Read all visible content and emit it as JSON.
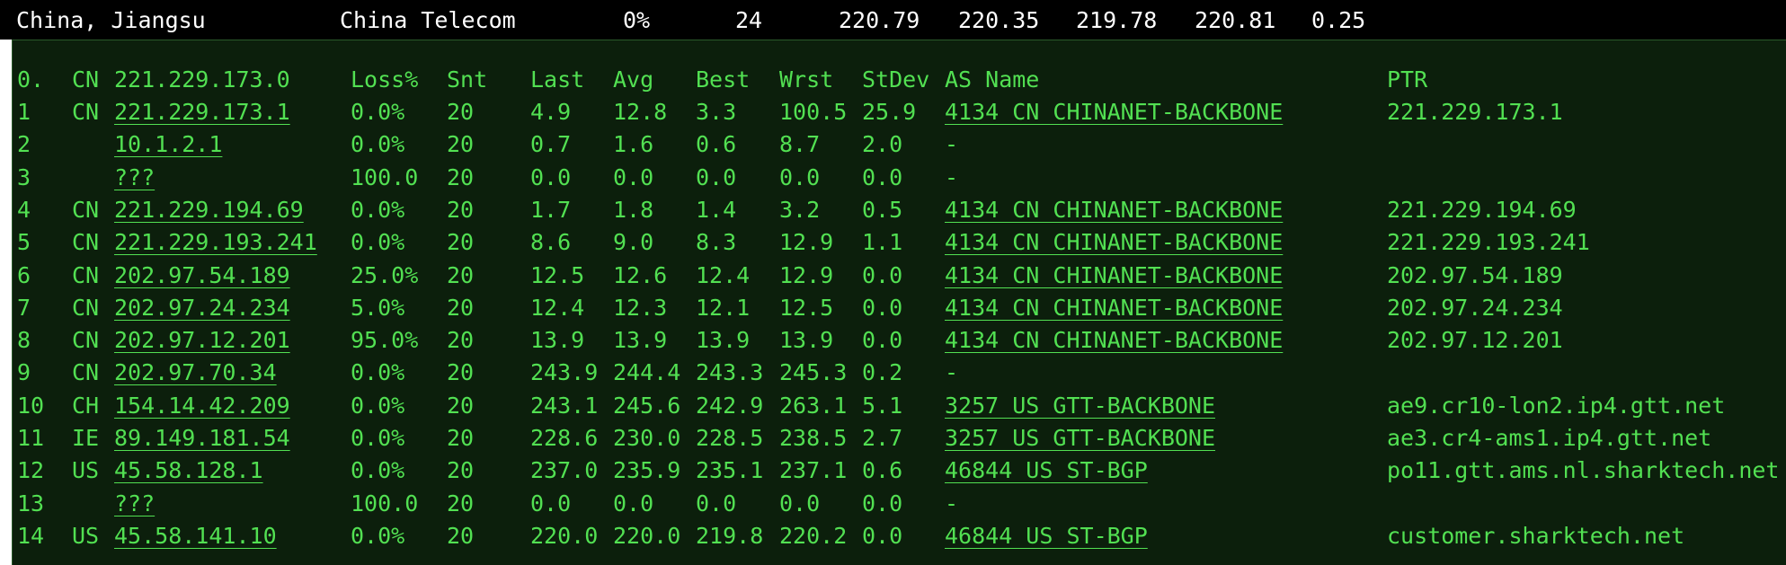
{
  "summary": {
    "location": "China, Jiangsu",
    "isp": "China Telecom",
    "loss": "0%",
    "sent": "24",
    "last": "220.79",
    "avg": "220.35",
    "best": "219.78",
    "worst": "220.81",
    "stdev": "0.25"
  },
  "colors": {
    "header_bg": "#000000",
    "header_text": "#ffffff",
    "panel_bg": "#0c1f0c",
    "text_green": "#52e052"
  },
  "table": {
    "header": {
      "hop": "0.",
      "cc": "CN",
      "host": "221.229.173.0",
      "loss": "Loss%",
      "snt": "Snt",
      "last": "Last",
      "avg": "Avg",
      "best": "Best",
      "wrst": "Wrst",
      "stdev": "StDev",
      "as_name": "AS Name",
      "ptr": "PTR"
    },
    "rows": [
      {
        "hop": "1",
        "cc": "CN",
        "host": "221.229.173.1",
        "loss": "0.0%",
        "snt": "20",
        "last": "4.9",
        "avg": "12.8",
        "best": "3.3",
        "wrst": "100.5",
        "stdev": "25.9",
        "as": "4134  CN CHINANET-BACKBONE",
        "ptr": "221.229.173.1"
      },
      {
        "hop": "2",
        "cc": "",
        "host": "10.1.2.1",
        "loss": "0.0%",
        "snt": "20",
        "last": "0.7",
        "avg": "1.6",
        "best": "0.6",
        "wrst": "8.7",
        "stdev": "2.0",
        "as": "-",
        "ptr": ""
      },
      {
        "hop": "3",
        "cc": "",
        "host": "???",
        "loss": "100.0",
        "snt": "20",
        "last": "0.0",
        "avg": "0.0",
        "best": "0.0",
        "wrst": "0.0",
        "stdev": "0.0",
        "as": "-",
        "ptr": ""
      },
      {
        "hop": "4",
        "cc": "CN",
        "host": "221.229.194.69",
        "loss": "0.0%",
        "snt": "20",
        "last": "1.7",
        "avg": "1.8",
        "best": "1.4",
        "wrst": "3.2",
        "stdev": "0.5",
        "as": "4134  CN CHINANET-BACKBONE",
        "ptr": "221.229.194.69"
      },
      {
        "hop": "5",
        "cc": "CN",
        "host": "221.229.193.241",
        "loss": "0.0%",
        "snt": "20",
        "last": "8.6",
        "avg": "9.0",
        "best": "8.3",
        "wrst": "12.9",
        "stdev": "1.1",
        "as": "4134  CN CHINANET-BACKBONE",
        "ptr": "221.229.193.241"
      },
      {
        "hop": "6",
        "cc": "CN",
        "host": "202.97.54.189",
        "loss": "25.0%",
        "snt": "20",
        "last": "12.5",
        "avg": "12.6",
        "best": "12.4",
        "wrst": "12.9",
        "stdev": "0.0",
        "as": "4134  CN CHINANET-BACKBONE",
        "ptr": "202.97.54.189"
      },
      {
        "hop": "7",
        "cc": "CN",
        "host": "202.97.24.234",
        "loss": "5.0%",
        "snt": "20",
        "last": "12.4",
        "avg": "12.3",
        "best": "12.1",
        "wrst": "12.5",
        "stdev": "0.0",
        "as": "4134  CN CHINANET-BACKBONE",
        "ptr": "202.97.24.234"
      },
      {
        "hop": "8",
        "cc": "CN",
        "host": "202.97.12.201",
        "loss": "95.0%",
        "snt": "20",
        "last": "13.9",
        "avg": "13.9",
        "best": "13.9",
        "wrst": "13.9",
        "stdev": "0.0",
        "as": "4134  CN CHINANET-BACKBONE",
        "ptr": "202.97.12.201"
      },
      {
        "hop": "9",
        "cc": "CN",
        "host": "202.97.70.34",
        "loss": "0.0%",
        "snt": "20",
        "last": "243.9",
        "avg": "244.4",
        "best": "243.3",
        "wrst": "245.3",
        "stdev": "0.2",
        "as": "-",
        "ptr": ""
      },
      {
        "hop": "10",
        "cc": "CH",
        "host": "154.14.42.209",
        "loss": "0.0%",
        "snt": "20",
        "last": "243.1",
        "avg": "245.6",
        "best": "242.9",
        "wrst": "263.1",
        "stdev": "5.1",
        "as": "3257  US GTT-BACKBONE",
        "ptr": "ae9.cr10-lon2.ip4.gtt.net"
      },
      {
        "hop": "11",
        "cc": "IE",
        "host": "89.149.181.54",
        "loss": "0.0%",
        "snt": "20",
        "last": "228.6",
        "avg": "230.0",
        "best": "228.5",
        "wrst": "238.5",
        "stdev": "2.7",
        "as": "3257  US GTT-BACKBONE",
        "ptr": "ae3.cr4-ams1.ip4.gtt.net"
      },
      {
        "hop": "12",
        "cc": "US",
        "host": "45.58.128.1",
        "loss": "0.0%",
        "snt": "20",
        "last": "237.0",
        "avg": "235.9",
        "best": "235.1",
        "wrst": "237.1",
        "stdev": "0.6",
        "as": "46844 US ST-BGP",
        "ptr": "po11.gtt.ams.nl.sharktech.net"
      },
      {
        "hop": "13",
        "cc": "",
        "host": "???",
        "loss": "100.0",
        "snt": "20",
        "last": "0.0",
        "avg": "0.0",
        "best": "0.0",
        "wrst": "0.0",
        "stdev": "0.0",
        "as": "-",
        "ptr": ""
      },
      {
        "hop": "14",
        "cc": "US",
        "host": "45.58.141.10",
        "loss": "0.0%",
        "snt": "20",
        "last": "220.0",
        "avg": "220.0",
        "best": "219.8",
        "wrst": "220.2",
        "stdev": "0.0",
        "as": "46844 US ST-BGP",
        "ptr": "customer.sharktech.net"
      }
    ]
  }
}
